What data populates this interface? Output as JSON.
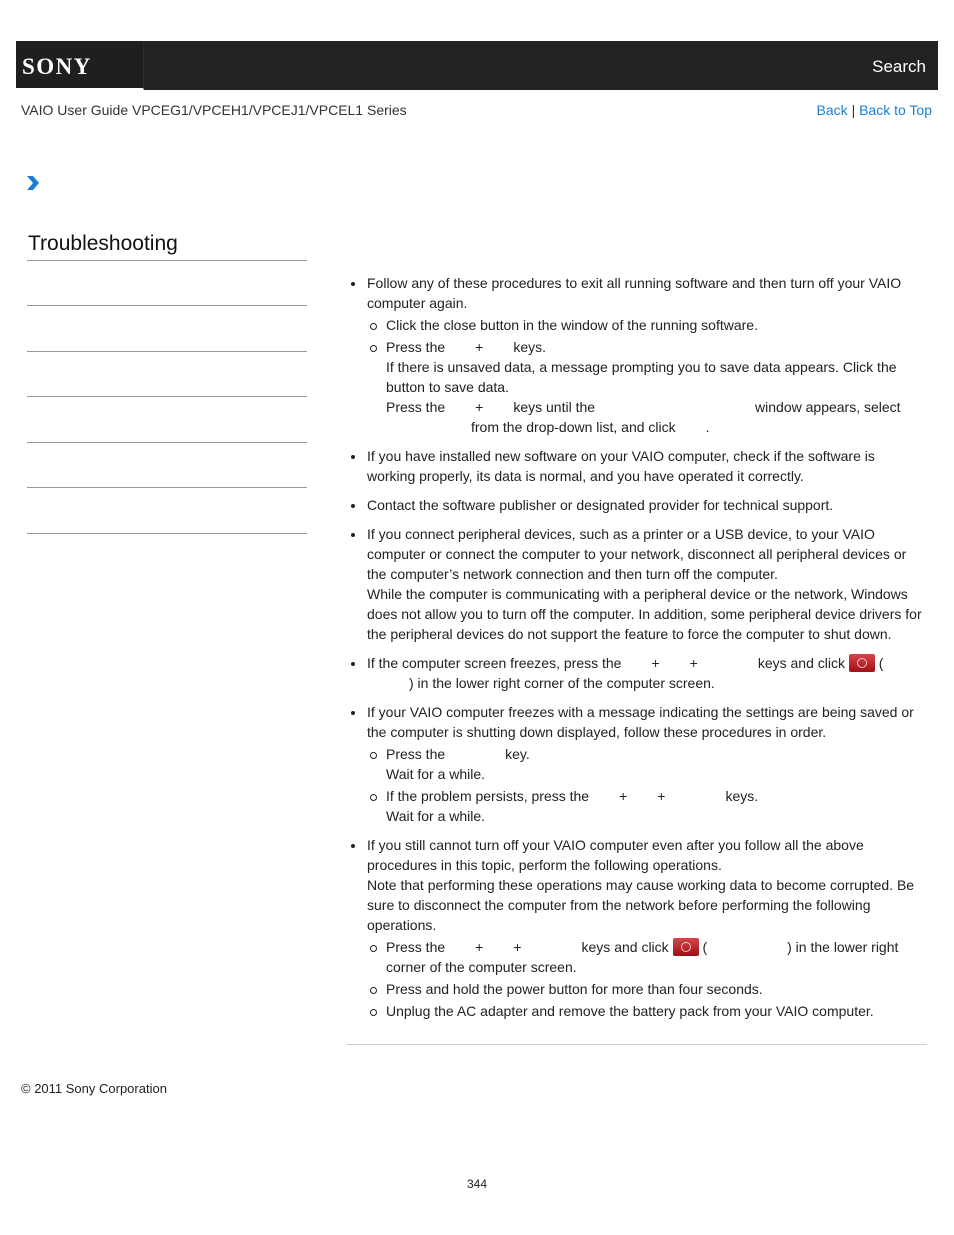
{
  "header": {
    "logo_text": "SONY",
    "search_label": "Search",
    "guide_title": "VAIO User Guide VPCEG1/VPCEH1/VPCEJ1/VPCEL1 Series",
    "back_label": "Back",
    "separator": "|",
    "back_to_top_label": "Back to Top"
  },
  "breadcrumb": {
    "icon": "chevron-right-icon"
  },
  "sidebar": {
    "title": "Troubleshooting",
    "item_count": 6
  },
  "content": {
    "b1": {
      "text": "Follow any of these procedures to exit all running software and then turn off your VAIO computer again.",
      "s1": "Click the close button in the window of the running software.",
      "s2_a": "Press the",
      "s2_plus": "+",
      "s2_b": "keys.",
      "s2_line2": "If there is unsaved data, a message prompting you to save data appears. Click the",
      "s2_line3": "button to save data.",
      "s2_line4_a": "Press the",
      "s2_line4_plus": "+",
      "s2_line4_b": "keys until the",
      "s2_line4_c": "window appears, select",
      "s2_line5_a": "from the drop-down list, and click",
      "s2_line5_b": "."
    },
    "b2": "If you have installed new software on your VAIO computer, check if the software is working properly, its data is normal, and you have operated it correctly.",
    "b3": "Contact the software publisher or designated provider for technical support.",
    "b4": {
      "p1": "If you connect peripheral devices, such as a printer or a USB device, to your VAIO computer or connect the computer to your network, disconnect all peripheral devices or the computer’s network connection and then turn off the computer.",
      "p2": "While the computer is communicating with a peripheral device or the network, Windows does not allow you to turn off the computer. In addition, some peripheral device drivers for the peripheral devices do not support the feature to force the computer to shut down."
    },
    "b5": {
      "a": "If the computer screen freezes, press the",
      "plus": "+",
      "b": "keys and click",
      "c": "(",
      "d": ") in the lower right corner of the computer screen."
    },
    "b6": {
      "text": "If your VAIO computer freezes with a message indicating the settings are being saved or the computer is shutting down displayed, follow these procedures in order.",
      "s1_a": "Press the",
      "s1_b": "key.",
      "s1_wait": "Wait for a while.",
      "s2_a": "If the problem persists, press the",
      "plus": "+",
      "s2_b": "keys.",
      "s2_wait": "Wait for a while."
    },
    "b7": {
      "p1": "If you still cannot turn off your VAIO computer even after you follow all the above procedures in this topic, perform the following operations.",
      "p2": "Note that performing these operations may cause working data to become corrupted. Be sure to disconnect the computer from the network before performing the following operations.",
      "s1_a": "Press the",
      "plus": "+",
      "s1_b": "keys and click",
      "s1_c": "(",
      "s1_d": ") in the lower right corner of the computer screen.",
      "s2": "Press and hold the power button for more than four seconds.",
      "s3": "Unplug the AC adapter and remove the battery pack from your VAIO computer."
    }
  },
  "footer": {
    "copyright": "© 2011 Sony Corporation",
    "page_number": "344"
  },
  "colors": {
    "header_bg": "#222222",
    "link": "#1a7fd4",
    "chevron": "#1a7fd4",
    "power_icon": "#b2171d"
  }
}
